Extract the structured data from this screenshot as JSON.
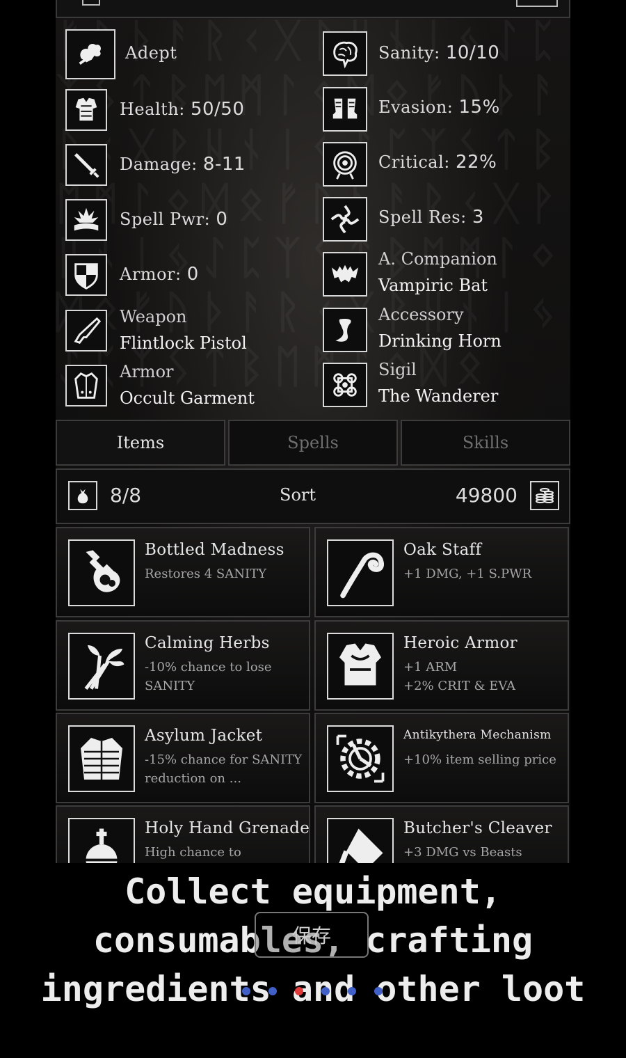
{
  "stats_left": [
    {
      "label": "Adept",
      "icon": "adept-icon"
    },
    {
      "label": "Health:",
      "value": "50/50",
      "icon": "armor-vest-icon"
    },
    {
      "label": "Damage:",
      "value": "8-11",
      "icon": "sword-icon"
    },
    {
      "label": "Spell Pwr:",
      "value": "0",
      "icon": "spellbook-icon"
    },
    {
      "label": "Armor:",
      "value": "0",
      "icon": "shield-icon"
    }
  ],
  "stats_right": [
    {
      "label": "Sanity:",
      "value": "10/10",
      "icon": "brain-icon"
    },
    {
      "label": "Evasion:",
      "value": "15%",
      "icon": "boots-icon"
    },
    {
      "label": "Critical:",
      "value": "22%",
      "icon": "target-icon"
    },
    {
      "label": "Spell Res:",
      "value": "3",
      "icon": "vortex-icon"
    }
  ],
  "equipment": {
    "companion": {
      "label": "A. Companion",
      "value": "Vampiric Bat",
      "icon": "bat-icon"
    },
    "weapon": {
      "label": "Weapon",
      "value": "Flintlock Pistol",
      "icon": "pistol-icon"
    },
    "accessory": {
      "label": "Accessory",
      "value": "Drinking Horn",
      "icon": "horn-icon"
    },
    "armor": {
      "label": "Armor",
      "value": "Occult Garment",
      "icon": "robe-icon"
    },
    "sigil": {
      "label": "Sigil",
      "value": "The Wanderer",
      "icon": "sigil-icon"
    }
  },
  "tabs": [
    "Items",
    "Spells",
    "Skills"
  ],
  "active_tab": "Items",
  "inventory": {
    "count": "8/8",
    "sort_label": "Sort",
    "gold": "49800"
  },
  "items": [
    {
      "name": "Bottled Madness",
      "desc": "Restores 4 SANITY",
      "icon": "potion-icon"
    },
    {
      "name": "Oak Staff",
      "desc": "+1 DMG, +1 S.PWR",
      "icon": "staff-icon"
    },
    {
      "name": "Calming Herbs",
      "desc": "-10% chance to lose SANITY",
      "icon": "herbs-icon"
    },
    {
      "name": "Heroic Armor",
      "desc": "+1 ARM\n+2% CRIT & EVA",
      "icon": "breastplate-icon"
    },
    {
      "name": "Asylum Jacket",
      "desc": "-15% chance for SANITY reduction on ...",
      "icon": "jacket-icon"
    },
    {
      "name": "Antikythera Mechanism",
      "desc": "+10% item selling price",
      "icon": "mechanism-icon"
    },
    {
      "name": "Holy Hand Grenade",
      "desc": "High chance to",
      "icon": "grenade-icon"
    },
    {
      "name": "Butcher's Cleaver",
      "desc": "+3 DMG vs Beasts",
      "icon": "cleaver-icon"
    }
  ],
  "caption": "Collect equipment, consumables, crafting ingredients and other loot",
  "save_button": "保存",
  "pager": {
    "total": 6,
    "current": 3,
    "active_color": "#e03a3a",
    "inactive_color": "#4060c8"
  }
}
